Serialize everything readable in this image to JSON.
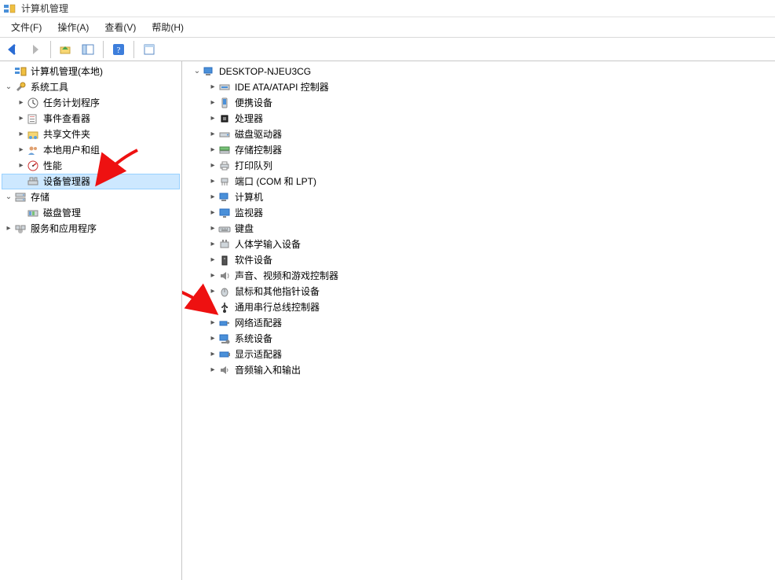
{
  "title": "计算机管理",
  "menu": {
    "file": "文件(F)",
    "action": "操作(A)",
    "view": "查看(V)",
    "help": "帮助(H)"
  },
  "toolbar": {
    "back": "后退",
    "forward": "前进",
    "up": "上移",
    "show_hide": "显示/隐藏控制台树",
    "help": "帮助",
    "properties": "属性"
  },
  "left": {
    "root": "计算机管理(本地)",
    "system_tools": "系统工具",
    "task_scheduler": "任务计划程序",
    "event_viewer": "事件查看器",
    "shared_folders": "共享文件夹",
    "local_users": "本地用户和组",
    "performance": "性能",
    "device_manager": "设备管理器",
    "storage": "存储",
    "disk_mgmt": "磁盘管理",
    "services_apps": "服务和应用程序"
  },
  "right": {
    "root": "DESKTOP-NJEU3CG",
    "ide": "IDE ATA/ATAPI 控制器",
    "portable": "便携设备",
    "cpu": "处理器",
    "disk_drives": "磁盘驱动器",
    "storage_ctrl": "存储控制器",
    "print_queue": "打印队列",
    "ports": "端口 (COM 和 LPT)",
    "computer": "计算机",
    "monitor": "监视器",
    "keyboard": "键盘",
    "hid": "人体学输入设备",
    "software_dev": "软件设备",
    "sound": "声音、视频和游戏控制器",
    "mouse": "鼠标和其他指针设备",
    "usb": "通用串行总线控制器",
    "network": "网络适配器",
    "system_dev": "系统设备",
    "display": "显示适配器",
    "audio_io": "音频输入和输出"
  }
}
